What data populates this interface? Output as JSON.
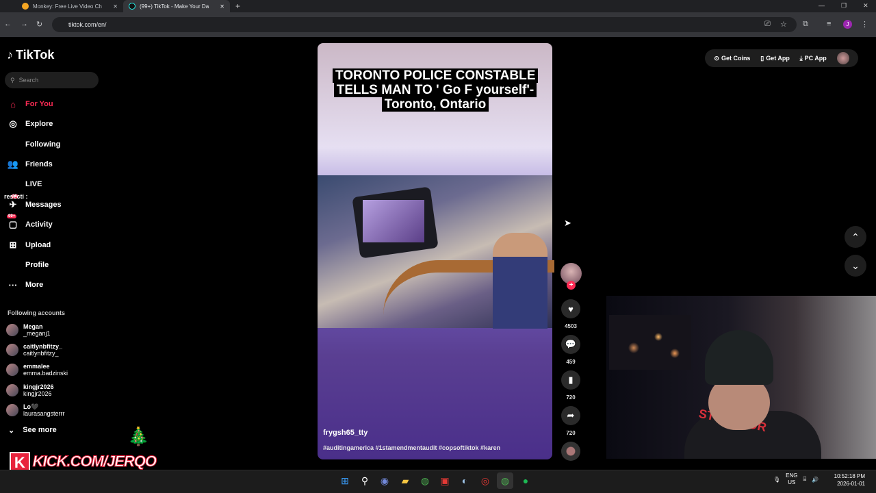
{
  "browser": {
    "tabs": [
      {
        "title": "Monkey: Free Live Video Ch",
        "active": false
      },
      {
        "title": "(99+) TikTok - Make Your Da",
        "active": true
      }
    ],
    "url": "tiktok.com/en/",
    "profile_initial": "J"
  },
  "tiktok": {
    "logo": "TikTok",
    "search_placeholder": "Search",
    "nav": [
      {
        "label": "For You",
        "icon": "home-icon",
        "active": true
      },
      {
        "label": "Explore",
        "icon": "compass-icon"
      },
      {
        "label": "Following",
        "icon": "following-avatar"
      },
      {
        "label": "Friends",
        "icon": "friends-icon"
      },
      {
        "label": "LIVE",
        "icon": "live-avatar"
      },
      {
        "label": "Messages",
        "icon": "messages-icon",
        "badge": "30"
      },
      {
        "label": "Activity",
        "icon": "activity-icon",
        "badge": "99+"
      },
      {
        "label": "Upload",
        "icon": "upload-icon"
      },
      {
        "label": "Profile",
        "icon": "profile-avatar"
      },
      {
        "label": "More",
        "icon": "more-icon"
      }
    ],
    "following_title": "Following accounts",
    "accounts": [
      {
        "name": "Megan",
        "handle": "_meganj1"
      },
      {
        "name": "caitlynbfitzy_",
        "handle": "caitlynbfitzy_"
      },
      {
        "name": "emmalee",
        "handle": "emma.badzinski"
      },
      {
        "name": "kingjr2026",
        "handle": "kingjr2026"
      },
      {
        "name": "Lo🖤",
        "handle": "laurasangsterrr"
      }
    ],
    "see_more": "See more",
    "top_buttons": {
      "coins": "Get Coins",
      "app": "Get App",
      "pc": "PC App"
    },
    "video": {
      "caption": "TORONTO POLICE CONSTABLE TELLS MAN TO ' Go F yourself'- Toronto, Ontario",
      "username": "frygsh65_tty",
      "hashtags": "#auditingamerica #1stamendmentaudit #copsoftiktok #karen"
    },
    "actions": {
      "likes": "4503",
      "comments": "459",
      "saves": "720",
      "shares": "720"
    }
  },
  "overlay": {
    "kick_logo": "K",
    "kick_text": "KICK.COM/JERQO",
    "chat_fragment": "resecti :",
    "shirt_text": "STORSPOR"
  },
  "taskbar": {
    "lang": "ENG",
    "region": "US",
    "time": "10:52:18 PM",
    "date": "2026-01-01"
  },
  "colors": {
    "accent": "#fe2c55",
    "background": "#000000",
    "kick": "#e8233d"
  }
}
